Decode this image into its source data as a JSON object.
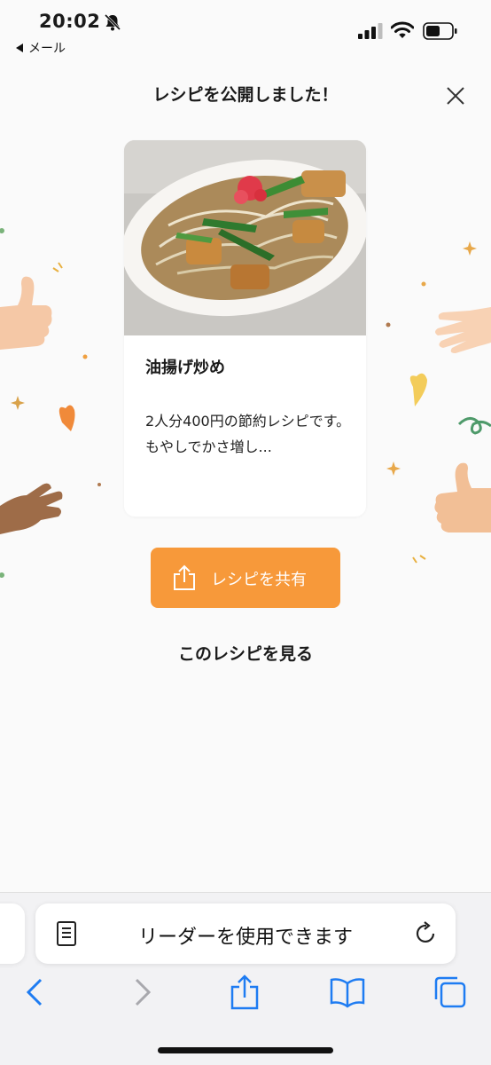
{
  "status_bar": {
    "time": "20:02",
    "back_app": "メール"
  },
  "header": {
    "title": "レシピを公開しました！"
  },
  "recipe_card": {
    "title": "油揚げ炒め",
    "description": "2人分400円の節約レシピです。 もやしでかさ増し..."
  },
  "actions": {
    "share_label": "レシピを共有",
    "view_label": "このレシピを見る"
  },
  "browser": {
    "address_text": "リーダーを使用できます"
  },
  "colors": {
    "accent": "#f7993a",
    "ios_blue": "#1e7cf2"
  },
  "icons": [
    "bell-slash-icon",
    "signal-icon",
    "wifi-icon",
    "battery-icon",
    "close-icon",
    "share-icon",
    "reader-icon",
    "reload-icon",
    "back-icon",
    "forward-icon",
    "toolbar-share-icon",
    "bookmarks-icon",
    "tabs-icon"
  ]
}
